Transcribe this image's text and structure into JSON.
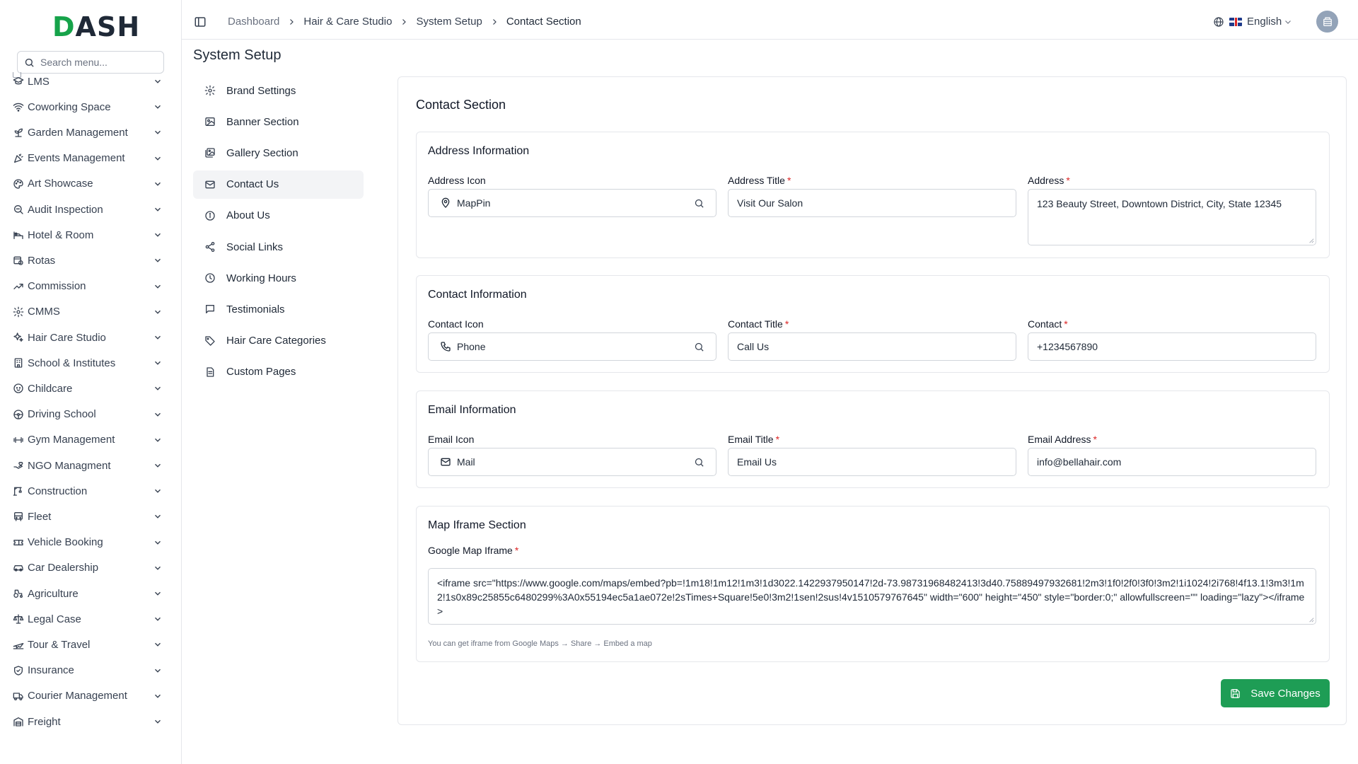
{
  "brand": {
    "logo_first": "D",
    "logo_rest": "ASH"
  },
  "sidebar": {
    "search_placeholder": "Search menu...",
    "items": [
      {
        "label": "LMS",
        "icon": "graduation-cap-icon"
      },
      {
        "label": "Coworking Space",
        "icon": "wifi-icon"
      },
      {
        "label": "Garden Management",
        "icon": "plant-icon"
      },
      {
        "label": "Events Management",
        "icon": "party-icon"
      },
      {
        "label": "Art Showcase",
        "icon": "palette-icon"
      },
      {
        "label": "Audit Inspection",
        "icon": "search-zoom-icon"
      },
      {
        "label": "Hotel & Room",
        "icon": "bed-icon"
      },
      {
        "label": "Rotas",
        "icon": "calendar-clock-icon"
      },
      {
        "label": "Commission",
        "icon": "trending-up-icon"
      },
      {
        "label": "CMMS",
        "icon": "settings-icon"
      },
      {
        "label": "Hair Care Studio",
        "icon": "sparkles-icon"
      },
      {
        "label": "School & Institutes",
        "icon": "building-icon"
      },
      {
        "label": "Childcare",
        "icon": "baby-icon"
      },
      {
        "label": "Driving School",
        "icon": "steering-wheel-icon"
      },
      {
        "label": "Gym Management",
        "icon": "dumbbell-icon"
      },
      {
        "label": "NGO Managment",
        "icon": "hand-heart-icon"
      },
      {
        "label": "Construction",
        "icon": "crane-icon"
      },
      {
        "label": "Fleet",
        "icon": "bus-icon"
      },
      {
        "label": "Vehicle Booking",
        "icon": "ticket-icon"
      },
      {
        "label": "Car Dealership",
        "icon": "car-icon"
      },
      {
        "label": "Agriculture",
        "icon": "tractor-icon"
      },
      {
        "label": "Legal Case",
        "icon": "scale-icon"
      },
      {
        "label": "Tour & Travel",
        "icon": "plane-icon"
      },
      {
        "label": "Insurance",
        "icon": "shield-icon"
      },
      {
        "label": "Courier Management",
        "icon": "truck-icon"
      },
      {
        "label": "Freight",
        "icon": "warehouse-icon"
      }
    ]
  },
  "topbar": {
    "breadcrumb": [
      "Dashboard",
      "Hair & Care Studio",
      "System Setup",
      "Contact Section"
    ],
    "language": "English"
  },
  "page": {
    "title": "System Setup"
  },
  "settings_nav": {
    "items": [
      {
        "label": "Brand Settings",
        "icon": "gear-icon",
        "active": false
      },
      {
        "label": "Banner Section",
        "icon": "image-icon",
        "active": false
      },
      {
        "label": "Gallery Section",
        "icon": "images-icon",
        "active": false
      },
      {
        "label": "Contact Us",
        "icon": "mail-icon",
        "active": true
      },
      {
        "label": "About Us",
        "icon": "info-icon",
        "active": false
      },
      {
        "label": "Social Links",
        "icon": "share-icon",
        "active": false
      },
      {
        "label": "Working Hours",
        "icon": "clock-icon",
        "active": false
      },
      {
        "label": "Testimonials",
        "icon": "message-icon",
        "active": false
      },
      {
        "label": "Hair Care Categories",
        "icon": "tag-icon",
        "active": false
      },
      {
        "label": "Custom Pages",
        "icon": "file-icon",
        "active": false
      }
    ]
  },
  "contact": {
    "title": "Contact Section",
    "address": {
      "heading": "Address Information",
      "icon_label": "Address Icon",
      "icon_value": "MapPin",
      "title_label": "Address Title",
      "title_value": "Visit Our Salon",
      "value_label": "Address",
      "value": "123 Beauty Street, Downtown District, City, State 12345"
    },
    "contact_info": {
      "heading": "Contact Information",
      "icon_label": "Contact Icon",
      "icon_value": "Phone",
      "title_label": "Contact Title",
      "title_value": "Call Us",
      "value_label": "Contact",
      "value": "+1234567890"
    },
    "email": {
      "heading": "Email Information",
      "icon_label": "Email Icon",
      "icon_value": "Mail",
      "title_label": "Email Title",
      "title_value": "Email Us",
      "value_label": "Email Address",
      "value": "info@bellahair.com"
    },
    "map": {
      "heading": "Map Iframe Section",
      "label": "Google Map Iframe",
      "value": "<iframe src=\"https://www.google.com/maps/embed?pb=!1m18!1m12!1m3!1d3022.1422937950147!2d-73.98731968482413!3d40.75889497932681!2m3!1f0!2f0!3f0!3m2!1i1024!2i768!4f13.1!3m3!1m2!1s0x89c25855c6480299%3A0x55194ec5a1ae072e!2sTimes+Square!5e0!3m2!1sen!2sus!4v1510579767645\" width=\"600\" height=\"450\" style=\"border:0;\" allowfullscreen=\"\" loading=\"lazy\"></iframe>",
      "hint": "You can get iframe from Google Maps → Share → Embed a map"
    },
    "required_mark": "*",
    "save_label": "Save Changes"
  },
  "colors": {
    "accent": "#1e9d55",
    "required": "#dc2626",
    "active_nav_bg": "#f3f4f6"
  }
}
